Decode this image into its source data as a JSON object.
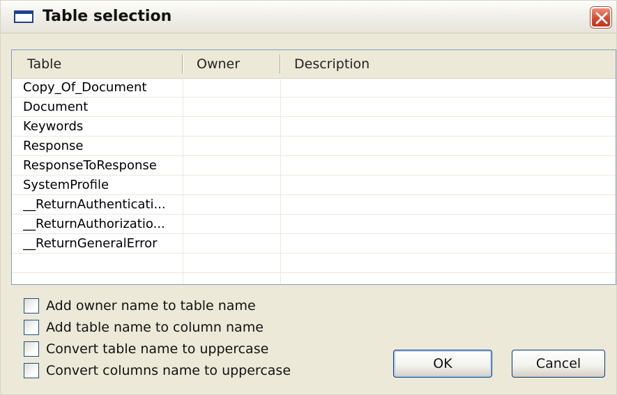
{
  "window": {
    "title": "Table selection"
  },
  "grid": {
    "columns": [
      "Table",
      "Owner",
      "Description"
    ],
    "rows": [
      [
        "Copy_Of_Document",
        "",
        ""
      ],
      [
        "Document",
        "",
        ""
      ],
      [
        "Keywords",
        "",
        ""
      ],
      [
        "Response",
        "",
        ""
      ],
      [
        "ResponseToResponse",
        "",
        ""
      ],
      [
        "SystemProfile",
        "",
        ""
      ],
      [
        "__ReturnAuthenticati...",
        "",
        ""
      ],
      [
        "__ReturnAuthorizatio...",
        "",
        ""
      ],
      [
        "__ReturnGeneralError",
        "",
        ""
      ],
      [
        "",
        "",
        ""
      ],
      [
        "",
        "",
        ""
      ]
    ]
  },
  "options": [
    {
      "label": "Add owner name to table name",
      "checked": false
    },
    {
      "label": "Add table name to column name",
      "checked": false
    },
    {
      "label": "Convert table name to uppercase",
      "checked": false
    },
    {
      "label": "Convert columns name to uppercase",
      "checked": false
    }
  ],
  "buttons": {
    "ok": "OK",
    "cancel": "Cancel"
  },
  "icons": {
    "window_icon": "window-icon",
    "close": "close-icon"
  },
  "colors": {
    "close_red": "#d5462b",
    "grid_border": "#7f9db9",
    "dialog_bg": "#ece9d8"
  }
}
